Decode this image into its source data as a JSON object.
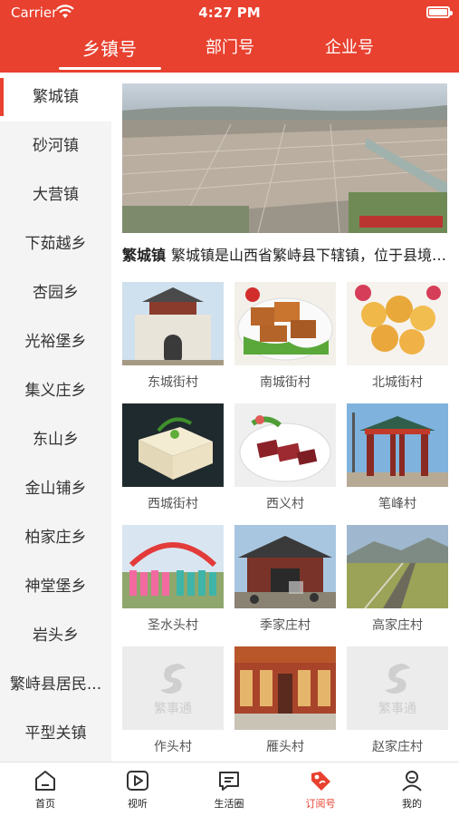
{
  "status": {
    "carrier": "Carrier",
    "time": "4:27 PM"
  },
  "tabs": [
    {
      "label": "乡镇号",
      "active": true
    },
    {
      "label": "部门号",
      "active": false
    },
    {
      "label": "企业号",
      "active": false
    }
  ],
  "sidebar": {
    "items": [
      {
        "label": "繁城镇",
        "active": true
      },
      {
        "label": "砂河镇"
      },
      {
        "label": "大营镇"
      },
      {
        "label": "下茹越乡"
      },
      {
        "label": "杏园乡"
      },
      {
        "label": "光裕堡乡"
      },
      {
        "label": "集义庄乡"
      },
      {
        "label": "东山乡"
      },
      {
        "label": "金山铺乡"
      },
      {
        "label": "柏家庄乡"
      },
      {
        "label": "神堂堡乡"
      },
      {
        "label": "岩头乡"
      },
      {
        "label": "繁峙县居民..."
      },
      {
        "label": "平型关镇"
      }
    ]
  },
  "main": {
    "intro_town": "繁城镇",
    "intro_text": "繁城镇是山西省繁峙县下辖镇，位于县境中部",
    "villages": [
      {
        "name": "东城街村",
        "thumb": "tower-gate"
      },
      {
        "name": "南城街村",
        "thumb": "tofu-dish"
      },
      {
        "name": "北城街村",
        "thumb": "fried-balls"
      },
      {
        "name": "西城街村",
        "thumb": "tofu-block"
      },
      {
        "name": "西义村",
        "thumb": "beef-plate"
      },
      {
        "name": "笔峰村",
        "thumb": "archway"
      },
      {
        "name": "圣水头村",
        "thumb": "dance-crowd"
      },
      {
        "name": "季家庄村",
        "thumb": "temple"
      },
      {
        "name": "高家庄村",
        "thumb": "countryside"
      },
      {
        "name": "作头村",
        "thumb": "placeholder"
      },
      {
        "name": "雁头村",
        "thumb": "building"
      },
      {
        "name": "赵家庄村",
        "thumb": "placeholder"
      }
    ],
    "placeholder_logo": "繁事通"
  },
  "bottom_nav": [
    {
      "label": "首页",
      "icon": "home-icon"
    },
    {
      "label": "视听",
      "icon": "play-icon"
    },
    {
      "label": "生活圈",
      "icon": "chat-icon"
    },
    {
      "label": "订阅号",
      "icon": "tag-icon",
      "active": true
    },
    {
      "label": "我的",
      "icon": "user-icon"
    }
  ],
  "colors": {
    "brand": "#e8412f",
    "sidebar_bg": "#f4f4f4"
  }
}
